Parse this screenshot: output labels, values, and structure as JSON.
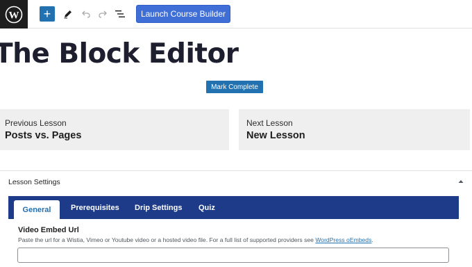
{
  "toolbar": {
    "logo_icon": "wordpress-logo",
    "add_icon": "+",
    "launch_label": "Launch Course Builder"
  },
  "post": {
    "title": "The Block Editor",
    "mark_complete_label": "Mark Complete"
  },
  "lesson_nav": {
    "previous": {
      "caption": "Previous Lesson",
      "title": "Posts vs. Pages"
    },
    "next": {
      "caption": "Next Lesson",
      "title": "New Lesson"
    }
  },
  "lesson_settings": {
    "header": "Lesson Settings",
    "tabs": [
      {
        "label": "General",
        "active": true
      },
      {
        "label": "Prerequisites",
        "active": false
      },
      {
        "label": "Drip Settings",
        "active": false
      },
      {
        "label": "Quiz",
        "active": false
      }
    ],
    "video_field": {
      "label": "Video Embed Url",
      "help_text": "Paste the url for a Wistia, Vimeo or Youtube video or a hosted video file. For a full list of supported providers see ",
      "help_link": "WordPress oEmbeds",
      "help_suffix": ".",
      "value": ""
    }
  },
  "colors": {
    "accent": "#2271b1",
    "launch_button": "#3f6fd6",
    "tabs_bar": "#1e3b8a",
    "nav_card_bg": "#efefef",
    "logo_bg": "#1e1e1e"
  }
}
